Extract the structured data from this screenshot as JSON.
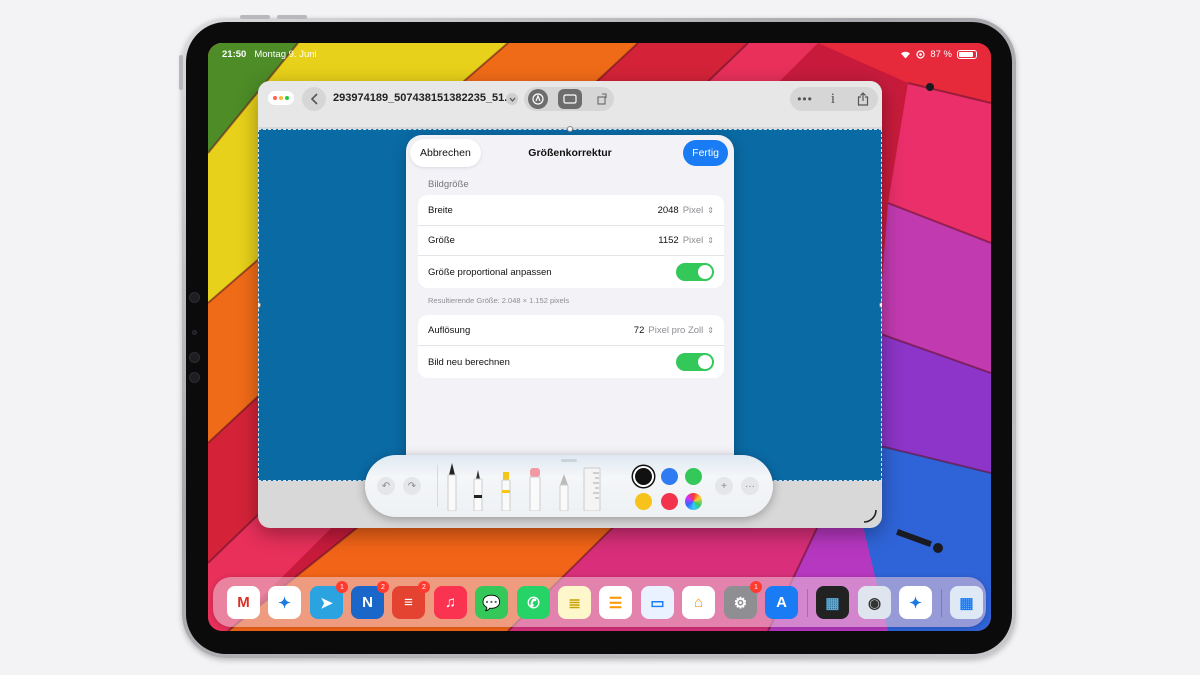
{
  "status_bar": {
    "time": "21:50",
    "date": "Montag 9. Juni",
    "battery": "87 %",
    "battery_level": 0.87
  },
  "window": {
    "document_title": "293974189_507438151382235_51...",
    "toolbar_icons": [
      "back-icon",
      "title-chevron-icon",
      "markup-icon",
      "crop-icon",
      "rotate-icon",
      "more-icon",
      "info-icon",
      "share-icon"
    ]
  },
  "dialog": {
    "title": "Größenkorrektur",
    "cancel_label": "Abbrechen",
    "done_label": "Fertig",
    "section_label": "Bildgröße",
    "rows": {
      "width": {
        "label": "Breite",
        "value": "2048",
        "unit": "Pixel"
      },
      "height": {
        "label": "Größe",
        "value": "1152",
        "unit": "Pixel"
      },
      "proportional": {
        "label": "Größe proportional anpassen",
        "on": true
      }
    },
    "result_note": "Resultierende Größe: 2.048 × 1.152 pixels",
    "resolution": {
      "label": "Auflösung",
      "value": "72",
      "unit": "Pixel pro Zoll"
    },
    "resample": {
      "label": "Bild neu berechnen",
      "on": true
    }
  },
  "palette": {
    "colors": [
      "#111111",
      "#2f7bf2",
      "#34c759",
      "#f7c31a",
      "#f2334b"
    ],
    "selected_color": "#111111",
    "tools": [
      "pen-tool",
      "fineliner-tool",
      "marker-tool",
      "eraser-tool",
      "pencil-tool",
      "ruler-tool"
    ]
  },
  "dock": {
    "apps": [
      {
        "name": "Gmail",
        "badge": ""
      },
      {
        "name": "Safari",
        "badge": ""
      },
      {
        "name": "Telegram",
        "badge": "1"
      },
      {
        "name": "NetNewsWire",
        "badge": "2"
      },
      {
        "name": "Todoist",
        "badge": "2"
      },
      {
        "name": "Musik",
        "badge": ""
      },
      {
        "name": "Nachrichten",
        "badge": ""
      },
      {
        "name": "WhatsApp",
        "badge": ""
      },
      {
        "name": "Notizen",
        "badge": ""
      },
      {
        "name": "Erinnerungen",
        "badge": ""
      },
      {
        "name": "Dateien",
        "badge": ""
      },
      {
        "name": "Home",
        "badge": ""
      },
      {
        "name": "Einstellungen",
        "badge": "1"
      },
      {
        "name": "App Store",
        "badge": ""
      },
      {
        "name": "Screens",
        "badge": ""
      },
      {
        "name": "Terminal",
        "badge": ""
      },
      {
        "name": "Safari",
        "badge": ""
      },
      {
        "name": "App-Mediathek",
        "badge": ""
      }
    ]
  }
}
